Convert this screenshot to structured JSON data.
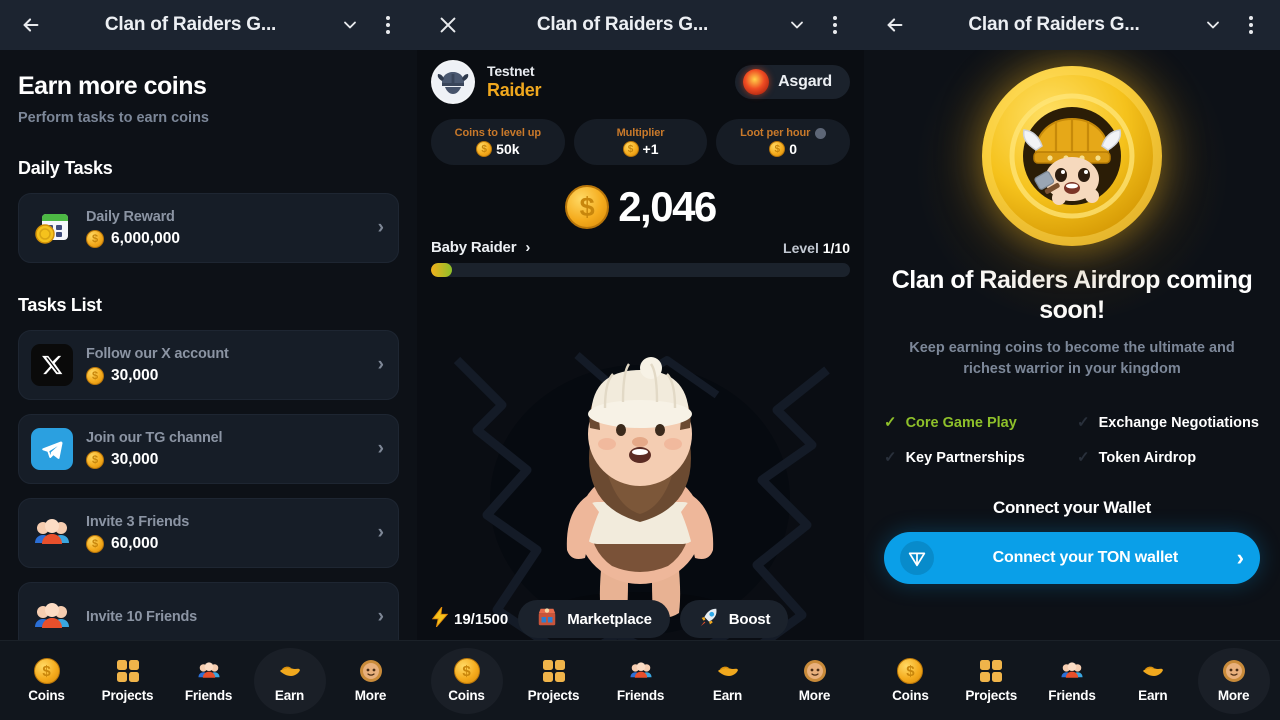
{
  "headers": [
    {
      "back_icon": "arrow-left-icon",
      "title": "Clan of Raiders G...",
      "chevron": "chevron-down-icon",
      "menu": "kebab-menu-icon"
    },
    {
      "back_icon": "close-icon",
      "title": "Clan of Raiders G...",
      "chevron": "chevron-down-icon",
      "menu": "kebab-menu-icon"
    },
    {
      "back_icon": "arrow-left-icon",
      "title": "Clan of Raiders G...",
      "chevron": "chevron-down-icon",
      "menu": "kebab-menu-icon"
    }
  ],
  "left_panel": {
    "title": "Earn more coins",
    "subtitle": "Perform tasks to earn coins",
    "daily_section_title": "Daily Tasks",
    "daily_tasks": [
      {
        "name": "Daily Reward",
        "amount": "6,000,000",
        "icon": "calendar-coin-icon"
      }
    ],
    "tasks_section_title": "Tasks List",
    "tasks": [
      {
        "name": "Follow our X account",
        "amount": "30,000",
        "icon": "x-twitter-icon"
      },
      {
        "name": "Join our TG channel",
        "amount": "30,000",
        "icon": "telegram-icon"
      },
      {
        "name": "Invite 3 Friends",
        "amount": "60,000",
        "icon": "friends-icon"
      },
      {
        "name": "Invite 10 Friends",
        "amount": "",
        "icon": "friends-icon"
      }
    ]
  },
  "center_panel": {
    "user": {
      "line1": "Testnet",
      "line2": "Raider",
      "avatar": "viking-helmet-avatar"
    },
    "clan": {
      "name": "Asgard",
      "emblem": "fire-emblem-icon"
    },
    "stats": [
      {
        "label": "Coins to level up",
        "value": "50k",
        "info": false
      },
      {
        "label": "Multiplier",
        "value": "+1",
        "info": false
      },
      {
        "label": "Loot per hour",
        "value": "0",
        "info": true
      }
    ],
    "balance": "2,046",
    "level_name": "Baby Raider",
    "level_value_label": "Level",
    "level_value": "1/10",
    "progress_percent": 5,
    "character": "baby-raider-character",
    "actions": {
      "energy": "19/1500",
      "energy_icon": "lightning-icon",
      "marketplace": "Marketplace",
      "marketplace_icon": "store-icon",
      "boost": "Boost",
      "boost_icon": "rocket-icon"
    }
  },
  "right_panel": {
    "coin_emblem": "viking-coin-icon",
    "headline": "Clan of Raiders Airdrop coming soon!",
    "subhead": "Keep earning coins to become the ultimate and richest warrior in your kingdom",
    "roadmap": [
      {
        "label": "Core Game Play",
        "done": true
      },
      {
        "label": "Exchange Negotiations",
        "done": false
      },
      {
        "label": "Key Partnerships",
        "done": false
      },
      {
        "label": "Token Airdrop",
        "done": false
      }
    ],
    "wallet_title": "Connect your Wallet",
    "wallet_button": "Connect your TON wallet",
    "wallet_icon": "ton-diamond-icon",
    "wallet_arrow": "chevron-right-icon"
  },
  "bottom_nav": {
    "items": [
      {
        "label": "Coins",
        "icon": "coin-icon"
      },
      {
        "label": "Projects",
        "icon": "grid-icon"
      },
      {
        "label": "Friends",
        "icon": "friends-icon"
      },
      {
        "label": "Earn",
        "icon": "hand-coin-icon"
      },
      {
        "label": "More",
        "icon": "avatar-more-icon"
      }
    ],
    "active": {
      "left": "Earn",
      "center": "Coins",
      "right": "More"
    }
  },
  "colors": {
    "background": "#0d1117",
    "card": "#161d27",
    "accent_gold": "#f0a81e",
    "accent_green": "#8ec02a",
    "ton_blue": "#0a9fe8",
    "header_bar": "#1c2430"
  }
}
